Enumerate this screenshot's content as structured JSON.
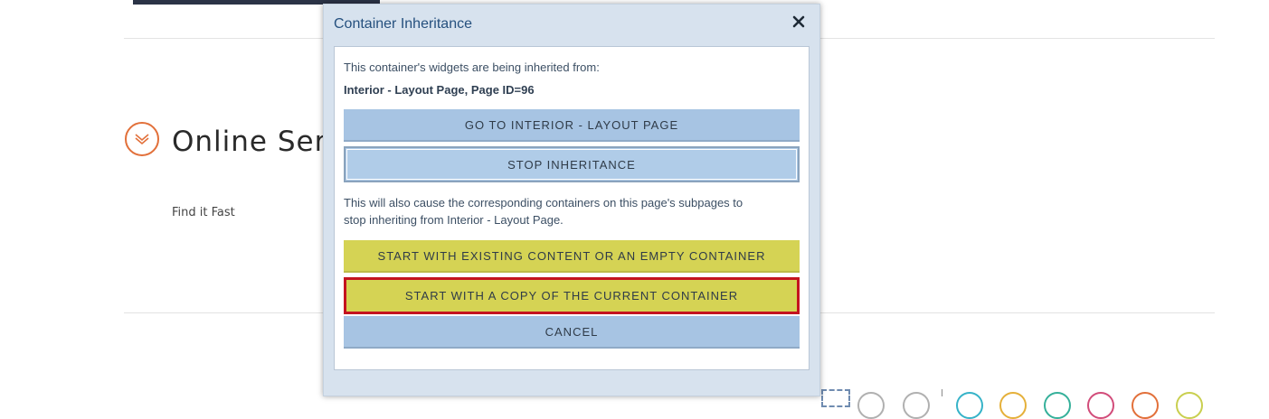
{
  "page": {
    "section_title": "Online Serv",
    "sub_link": "Find it Fast"
  },
  "dialog": {
    "title": "Container Inheritance",
    "intro_text": "This container's widgets are being inherited from:",
    "source_page": "Interior - Layout Page, Page ID=96",
    "buttons": {
      "go_to": "GO TO INTERIOR - LAYOUT PAGE",
      "stop": "STOP INHERITANCE",
      "start_existing": "START WITH EXISTING CONTENT OR AN EMPTY CONTAINER",
      "start_copy": "START WITH A COPY OF THE CURRENT CONTAINER",
      "cancel": "CANCEL"
    },
    "warning_line1": "This will also cause the corresponding containers on this page's subpages to",
    "warning_line2": "stop inheriting from Interior - Layout Page."
  },
  "colors": {
    "accent_orange": "#e2703a",
    "dialog_title": "#25507e",
    "button_blue": "#a7c4e3",
    "button_yellow": "#d5d354",
    "highlight_red": "#c4141f"
  },
  "icons": {
    "section_toggle": "chevron-down-circle-icon",
    "close": "close-icon"
  }
}
